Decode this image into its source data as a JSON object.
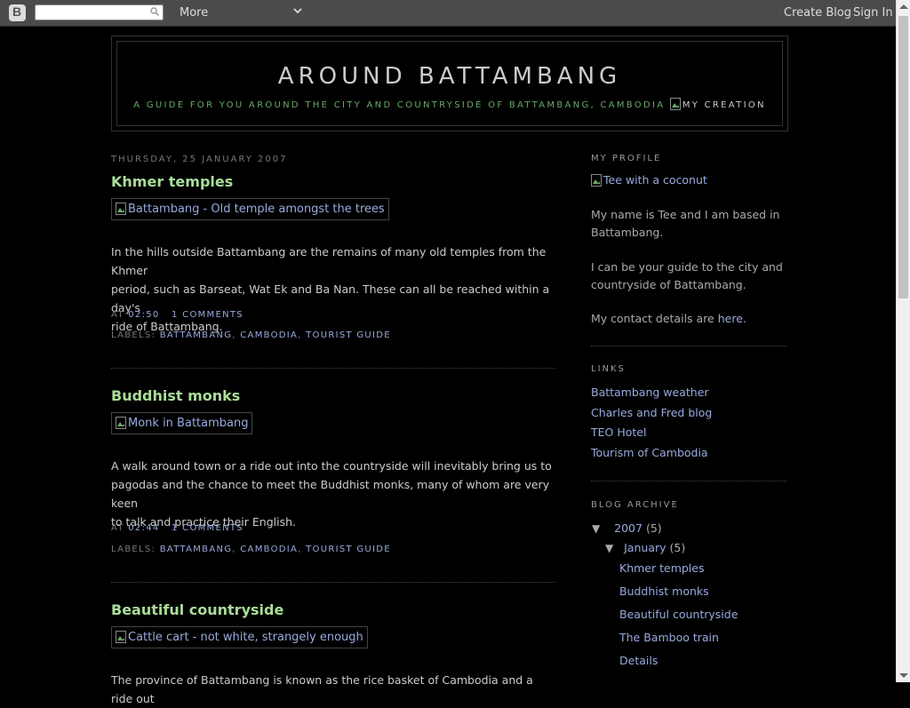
{
  "navbar": {
    "logo_letter": "B",
    "search_placeholder": "",
    "more_label": "More",
    "create_blog_label": "Create Blog",
    "sign_in_label": "Sign In"
  },
  "header": {
    "title": "AROUND BATTAMBANG",
    "description": "A GUIDE FOR YOU AROUND THE CITY AND COUNTRYSIDE OF BATTAMBANG, CAMBODIA",
    "image_alt": "MY CREATION"
  },
  "posts": [
    {
      "date": "THURSDAY, 25 JANUARY 2007",
      "title": "Khmer temples",
      "image_alt": "Battambang - Old temple amongst the trees",
      "body_lines": [
        "In the hills outside Battambang are the remains of many old temples from the Khmer",
        "period, such as Barseat, Wat Ek and Ba Nan. These can all be reached within a day's",
        "ride of Battambang."
      ],
      "at_label": "AT",
      "time": "02:50",
      "comments": "1 COMMENTS",
      "labels_label": "LABELS:",
      "labels": [
        "BATTAMBANG",
        "CAMBODIA",
        "TOURIST GUIDE"
      ]
    },
    {
      "title": "Buddhist monks",
      "image_alt": "Monk in Battambang",
      "body_lines": [
        "A walk around town or a ride out into the countryside will inevitably bring us to",
        "pagodas and the chance to meet the Buddhist monks, many of whom are very keen",
        "to talk and practice their English."
      ],
      "at_label": "AT",
      "time": "02:44",
      "comments": "1 COMMENTS",
      "labels_label": "LABELS:",
      "labels": [
        "BATTAMBANG",
        "CAMBODIA",
        "TOURIST GUIDE"
      ]
    },
    {
      "title": "Beautiful countryside",
      "image_alt": "Cattle cart - not white, strangely enough",
      "body_lines": [
        "The province of Battambang is known as the rice basket of Cambodia and a ride out"
      ]
    }
  ],
  "sidebar": {
    "profile": {
      "heading": "MY PROFILE",
      "image_alt": "Tee with a coconut",
      "para1": [
        "My name is Tee and I am based in",
        "Battambang."
      ],
      "para2": [
        "I can be your guide to the city and",
        "countryside of Battambang."
      ],
      "para3_prefix": "My contact details are ",
      "para3_link": "here",
      "para3_suffix": "."
    },
    "links": {
      "heading": "LINKS",
      "items": [
        "Battambang weather",
        "Charles and Fred blog",
        "TEO Hotel",
        "Tourism of Cambodia"
      ]
    },
    "archive": {
      "heading": "BLOG ARCHIVE",
      "year_toggle": "▼",
      "year": "2007",
      "year_count": "(5)",
      "month_toggle": "▼",
      "month": "January",
      "month_count": "(5)",
      "posts": [
        "Khmer temples",
        "Buddhist monks",
        "Beautiful countryside",
        "The Bamboo train",
        "Details"
      ]
    }
  }
}
